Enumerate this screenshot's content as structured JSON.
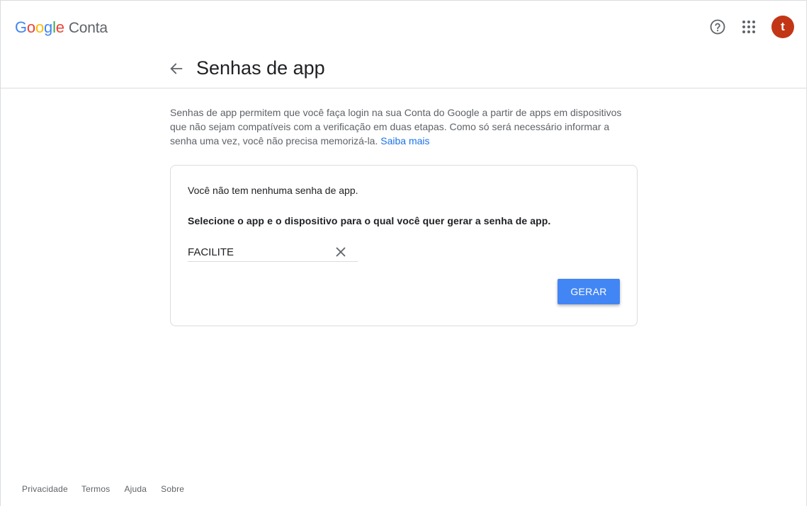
{
  "header": {
    "logo_parts": [
      "G",
      "o",
      "o",
      "g",
      "l",
      "e"
    ],
    "product_name": "Conta",
    "avatar_letter": "t",
    "avatar_color": "#c23616"
  },
  "page": {
    "title": "Senhas de app",
    "intro_text": "Senhas de app permitem que você faça login na sua Conta do Google a partir de apps em dispositivos que não sejam compatíveis com a verificação em duas etapas. Como só será necessário informar a senha uma vez, você não precisa memorizá-la.",
    "learn_more": "Saiba mais"
  },
  "card": {
    "no_passwords": "Você não tem nenhuma senha de app.",
    "select_instruction": "Selecione o app e o dispositivo para o qual você quer gerar a senha de app.",
    "app_field_value": "FACILITE",
    "generate_button": "GERAR"
  },
  "footer": {
    "links": [
      "Privacidade",
      "Termos",
      "Ajuda",
      "Sobre"
    ]
  },
  "icons": [
    "back-arrow-icon",
    "help-icon",
    "apps-grid-icon",
    "close-icon"
  ],
  "colors": {
    "primary_blue": "#4285f4",
    "link_blue": "#1a73e8",
    "text_secondary": "#5f6368"
  }
}
